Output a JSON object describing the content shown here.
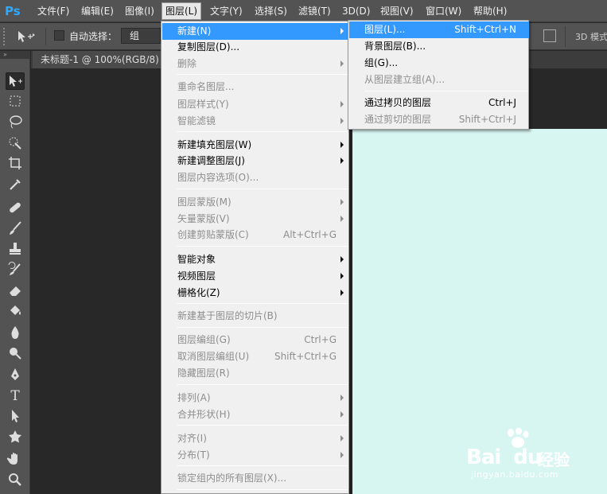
{
  "app": {
    "logo": "Ps"
  },
  "menubar": {
    "items": [
      {
        "label": "文件(F)"
      },
      {
        "label": "编辑(E)"
      },
      {
        "label": "图像(I)"
      },
      {
        "label": "图层(L)"
      },
      {
        "label": "文字(Y)"
      },
      {
        "label": "选择(S)"
      },
      {
        "label": "滤镜(T)"
      },
      {
        "label": "3D(D)"
      },
      {
        "label": "视图(V)"
      },
      {
        "label": "窗口(W)"
      },
      {
        "label": "帮助(H)"
      }
    ],
    "active_index": 3
  },
  "options_bar": {
    "tool_icon": "move-tool-icon",
    "auto_select_label": "自动选择：",
    "auto_select_checked": false,
    "group_value": "组",
    "mode_3d_label": "3D 模式"
  },
  "document": {
    "tab_title": "未标题-1 @ 100%(RGB/8) *",
    "canvas_color": "#d7f6f2"
  },
  "toolbox": {
    "grip": "»",
    "tools": [
      "move-tool-icon",
      "marquee-tool-icon",
      "lasso-tool-icon",
      "quick-selection-tool-icon",
      "crop-tool-icon",
      "eyedropper-tool-icon",
      "healing-brush-tool-icon",
      "brush-tool-icon",
      "clone-stamp-tool-icon",
      "history-brush-tool-icon",
      "eraser-tool-icon",
      "paint-bucket-tool-icon",
      "blur-tool-icon",
      "dodge-tool-icon",
      "pen-tool-icon",
      "type-tool-icon",
      "path-selection-tool-icon",
      "custom-shape-tool-icon",
      "hand-tool-icon",
      "zoom-tool-icon"
    ]
  },
  "layer_menu": {
    "items": [
      {
        "label": "新建(N)",
        "shortcut": "",
        "submenu": true,
        "disabled": false,
        "highlight": true
      },
      {
        "label": "复制图层(D)...",
        "shortcut": "",
        "submenu": false,
        "disabled": false
      },
      {
        "label": "删除",
        "shortcut": "",
        "submenu": true,
        "disabled": true
      },
      {
        "label": "重命名图层...",
        "shortcut": "",
        "submenu": false,
        "disabled": true
      },
      {
        "label": "图层样式(Y)",
        "shortcut": "",
        "submenu": true,
        "disabled": true
      },
      {
        "label": "智能滤镜",
        "shortcut": "",
        "submenu": true,
        "disabled": true
      },
      {
        "label": "新建填充图层(W)",
        "shortcut": "",
        "submenu": true,
        "disabled": false
      },
      {
        "label": "新建调整图层(J)",
        "shortcut": "",
        "submenu": true,
        "disabled": false
      },
      {
        "label": "图层内容选项(O)...",
        "shortcut": "",
        "submenu": false,
        "disabled": true
      },
      {
        "label": "图层蒙版(M)",
        "shortcut": "",
        "submenu": true,
        "disabled": true
      },
      {
        "label": "矢量蒙版(V)",
        "shortcut": "",
        "submenu": true,
        "disabled": true
      },
      {
        "label": "创建剪贴蒙版(C)",
        "shortcut": "Alt+Ctrl+G",
        "submenu": false,
        "disabled": true
      },
      {
        "label": "智能对象",
        "shortcut": "",
        "submenu": true,
        "disabled": false
      },
      {
        "label": "视频图层",
        "shortcut": "",
        "submenu": true,
        "disabled": false
      },
      {
        "label": "栅格化(Z)",
        "shortcut": "",
        "submenu": true,
        "disabled": false
      },
      {
        "label": "新建基于图层的切片(B)",
        "shortcut": "",
        "submenu": false,
        "disabled": true
      },
      {
        "label": "图层编组(G)",
        "shortcut": "Ctrl+G",
        "submenu": false,
        "disabled": true
      },
      {
        "label": "取消图层编组(U)",
        "shortcut": "Shift+Ctrl+G",
        "submenu": false,
        "disabled": true
      },
      {
        "label": "隐藏图层(R)",
        "shortcut": "",
        "submenu": false,
        "disabled": true
      },
      {
        "label": "排列(A)",
        "shortcut": "",
        "submenu": true,
        "disabled": true
      },
      {
        "label": "合并形状(H)",
        "shortcut": "",
        "submenu": true,
        "disabled": true
      },
      {
        "label": "对齐(I)",
        "shortcut": "",
        "submenu": true,
        "disabled": true
      },
      {
        "label": "分布(T)",
        "shortcut": "",
        "submenu": true,
        "disabled": true
      },
      {
        "label": "锁定组内的所有图层(X)...",
        "shortcut": "",
        "submenu": false,
        "disabled": true
      }
    ]
  },
  "new_submenu": {
    "items": [
      {
        "label": "图层(L)...",
        "shortcut": "Shift+Ctrl+N",
        "disabled": false,
        "highlight": true
      },
      {
        "label": "背景图层(B)...",
        "shortcut": "",
        "disabled": false
      },
      {
        "label": "组(G)...",
        "shortcut": "",
        "disabled": false
      },
      {
        "label": "从图层建立组(A)...",
        "shortcut": "",
        "disabled": true
      },
      {
        "label": "通过拷贝的图层",
        "shortcut": "Ctrl+J",
        "disabled": false
      },
      {
        "label": "通过剪切的图层",
        "shortcut": "Shift+Ctrl+J",
        "disabled": true
      }
    ]
  },
  "watermark": {
    "brand": "Bai",
    "brand_suffix": "du",
    "chinese": "经验",
    "url": "jingyan.baidu.com"
  }
}
